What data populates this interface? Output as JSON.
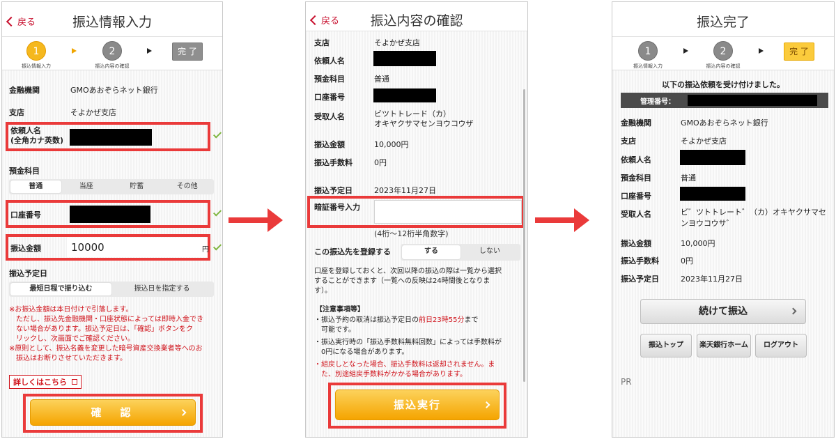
{
  "screen1": {
    "back": "戻る",
    "title": "振込情報入力",
    "steps": [
      {
        "num": "1",
        "label": "振込情報入力"
      },
      {
        "num": "2",
        "label": "振込内容の確認"
      }
    ],
    "done": "完 了",
    "bank_label": "金融機関",
    "bank_value": "GMOあおぞらネット銀行",
    "branch_label": "支店",
    "branch_value": "そよかぜ支店",
    "requester_label_1": "依頼人名",
    "requester_label_2": "(全角カナ英数)",
    "account_type_label": "預金科目",
    "account_types": [
      "普通",
      "当座",
      "貯蓄",
      "その他"
    ],
    "account_no_label": "口座番号",
    "amount_label": "振込金額",
    "amount_value": "10000",
    "amount_unit": "円",
    "date_label": "振込予定日",
    "date_options": [
      "最短日程で振り込む",
      "振込日を指定する"
    ],
    "notes": [
      "※お振込金額は本日付けで引落します。",
      "ただし、振込先金融機関・口座状態によっては即時入金でき",
      "ない場合があります。振込予定日は、「確認」ボタンをク",
      "リックし、次画面でご確認ください。",
      "※原則として、振込名義を変更した暗号資産交換業者等へのお",
      "振込はお断りさせていただきます。"
    ],
    "details_link": "詳しくはこちら",
    "confirm_button": "確　認"
  },
  "screen2": {
    "back": "戻る",
    "title": "振込内容の確認",
    "branch_label": "支店",
    "branch_value": "そよかぜ支店",
    "requester_label": "依頼人名",
    "type_label": "預金科目",
    "type_value": "普通",
    "account_label": "口座番号",
    "recipient_label": "受取人名",
    "recipient_value_1": "ビツトトレード（カ）",
    "recipient_value_2": "オキヤクサマセンヨウコウザ",
    "amount_label": "振込金額",
    "amount_value": "10,000円",
    "fee_label": "振込手数料",
    "fee_value": "0円",
    "date_label": "振込予定日",
    "date_value": "2023年11月27日",
    "pin_label": "暗証番号入力",
    "pin_hint": "(4桁〜12桁半角数字)",
    "register_label": "この振込先を登録する",
    "register_options": [
      "する",
      "しない"
    ],
    "register_note": [
      "口座を登録しておくと、次回以降の振込の際は一覧から選択",
      "することができます（一覧への反映は24時間後となりま",
      "す）。"
    ],
    "caution_title": "【注意事項等】",
    "caution_1a": "・振込予約の取消は振込予定日の",
    "caution_1b": "前日23時55分",
    "caution_1c": "まで",
    "caution_1d": "可能です。",
    "caution_2a": "・振込実行時の「振込手数料無料回数」によっては手数料が",
    "caution_2b": "0円になる場合があります。",
    "caution_3a": "・組戻しとなった場合、振込手数料は返却されません。ま",
    "caution_3b": "た、別途組戻手数料がかかる場合があります。",
    "execute_button": "振込実行"
  },
  "screen3": {
    "title": "振込完了",
    "steps": [
      {
        "num": "1",
        "label": "振込情報入力"
      },
      {
        "num": "2",
        "label": "振込内容の確認"
      }
    ],
    "done": "完 了",
    "accepted_msg": "以下の振込依頼を受け付けました。",
    "mgmt_label": "管理番号：",
    "bank_label": "金融機関",
    "bank_value": "GMOあおぞらネット銀行",
    "branch_label": "支店",
    "branch_value": "そよかぜ支店",
    "requester_label": "依頼人名",
    "type_label": "預金科目",
    "type_value": "普通",
    "account_label": "口座番号",
    "recipient_label": "受取人名",
    "recipient_value_1": "ビ゛ツトトレート゛（カ）オキヤクサマセ",
    "recipient_value_2": "ンヨウコウサ゛",
    "amount_label": "振込金額",
    "amount_value": "10,000円",
    "fee_label": "振込手数料",
    "fee_value": "0円",
    "date_label": "振込予定日",
    "date_value": "2023年11月27日",
    "continue_button": "続けて振込",
    "nav_buttons": [
      "振込トップ",
      "楽天銀行ホーム",
      "ログアウト"
    ],
    "pr": "PR"
  },
  "colors": {
    "highlight": "#ea3a3a",
    "accent": "#f5a400",
    "brand_red": "#c8102e"
  }
}
